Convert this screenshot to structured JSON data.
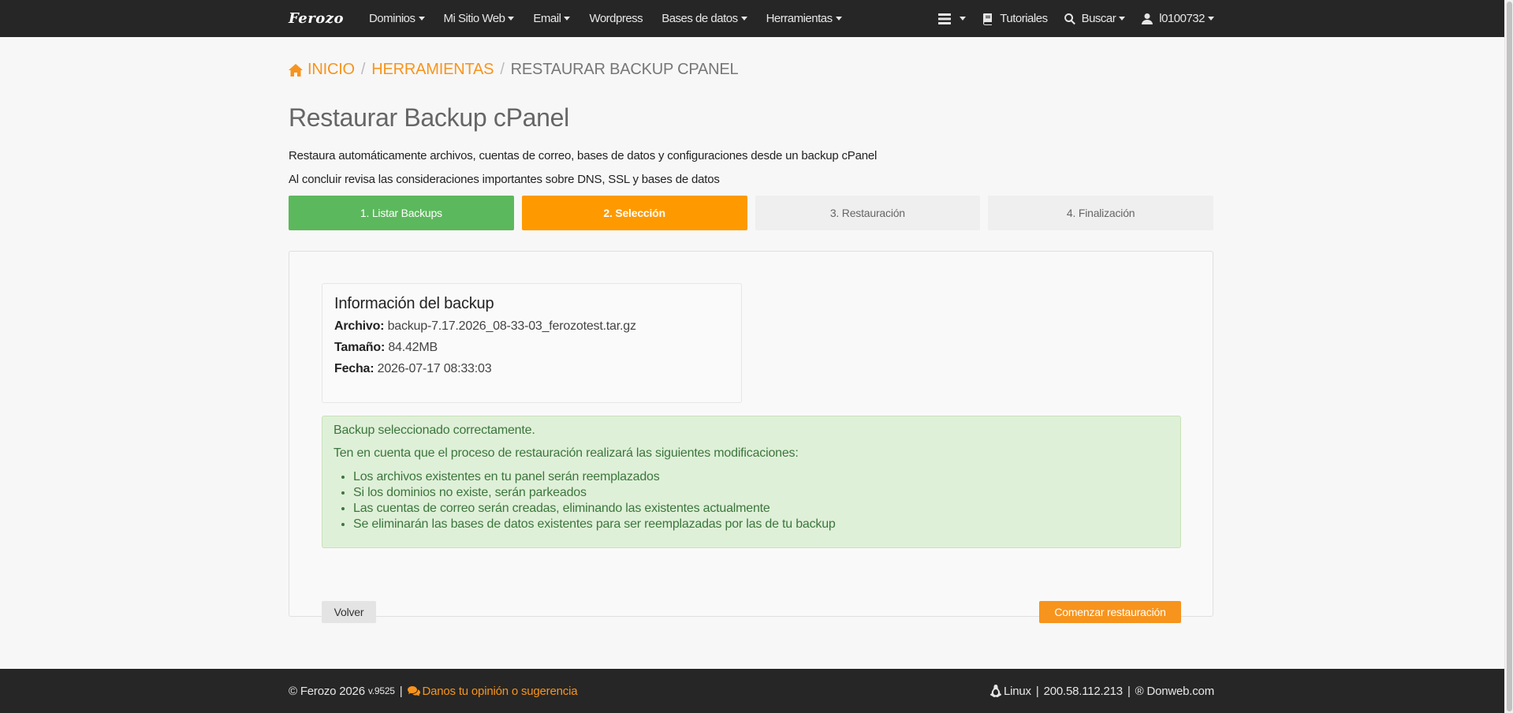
{
  "navbar": {
    "logo": "Ferozo",
    "menu": [
      {
        "label": "Dominios",
        "dropdown": true
      },
      {
        "label": "Mi Sitio Web",
        "dropdown": true
      },
      {
        "label": "Email",
        "dropdown": true
      },
      {
        "label": "Wordpress",
        "dropdown": false
      },
      {
        "label": "Bases de datos",
        "dropdown": true
      },
      {
        "label": "Herramientas",
        "dropdown": true
      }
    ],
    "right": {
      "servers_icon": "server-list-icon",
      "tutorials_label": "Tutoriales",
      "search_label": "Buscar",
      "user_label": "l0100732"
    }
  },
  "breadcrumb": {
    "home_label": "INICIO",
    "tools_label": "HERRAMIENTAS",
    "current_label": "RESTAURAR BACKUP CPANEL"
  },
  "page": {
    "title": "Restaurar Backup cPanel",
    "description_1": "Restaura automáticamente archivos, cuentas de correo, bases de datos y configuraciones desde un backup cPanel",
    "description_2": "Al concluir revisa las consideraciones importantes sobre DNS, SSL y bases de datos"
  },
  "steps": [
    {
      "label": "1. Listar Backups",
      "state": "done"
    },
    {
      "label": "2. Selección",
      "state": "active"
    },
    {
      "label": "3. Restauración",
      "state": "pending"
    },
    {
      "label": "4. Finalización",
      "state": "pending"
    }
  ],
  "backup_info": {
    "title": "Información del backup",
    "file_label": "Archivo:",
    "file_value": "backup-7.17.2026_08-33-03_ferozotest.tar.gz",
    "size_label": "Tamaño:",
    "size_value": "84.42MB",
    "date_label": "Fecha:",
    "date_value": "2026-07-17 08:33:03"
  },
  "alert": {
    "title": "Backup seleccionado correctamente.",
    "intro": "Ten en cuenta que el proceso de restauración realizará las siguientes modificaciones:",
    "items": [
      "Los archivos existentes en tu panel serán reemplazados",
      "Si los dominios no existe, serán parkeados",
      "Las cuentas de correo serán creadas, eliminando las existentes actualmente",
      "Se eliminarán las bases de datos existentes para ser reemplazadas por las de tu backup"
    ]
  },
  "buttons": {
    "back_label": "Volver",
    "start_label": "Comenzar restauración"
  },
  "footer": {
    "copyright": "© Ferozo 2026",
    "version": "v.9525",
    "feedback_label": "Danos tu opinión o sugerencia",
    "os_label": "Linux",
    "ip": "200.58.112.213",
    "brand": "® Donweb.com"
  },
  "colors": {
    "accent": "#f7941d",
    "step_done": "#5cb85c",
    "step_active": "#ff9900",
    "navbar_bg": "#262626",
    "alert_bg": "#dff0d8",
    "alert_text": "#3c763d"
  }
}
